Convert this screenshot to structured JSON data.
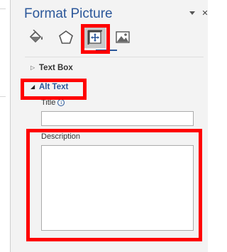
{
  "pane": {
    "title": "Format Picture",
    "controls": {
      "options_icon": "dropdown-caret-icon",
      "close_label": "✕"
    },
    "icon_tabs": [
      {
        "name": "fill-line",
        "icon": "paint-bucket-icon"
      },
      {
        "name": "effects",
        "icon": "pentagon-icon"
      },
      {
        "name": "size-properties",
        "icon": "size-properties-icon",
        "active": true
      },
      {
        "name": "picture",
        "icon": "picture-icon"
      }
    ],
    "sections": {
      "text_box": {
        "label": "Text Box",
        "arrow": "▷"
      },
      "alt_text": {
        "label": "Alt Text",
        "arrow": "◢"
      }
    },
    "fields": {
      "title_label": "Title",
      "title_info": "i",
      "title_value": "",
      "description_label": "Description",
      "description_value": ""
    }
  },
  "colors": {
    "accent": "#2b579a",
    "highlight": "#ff0000",
    "pane_background": "#f3f3f3"
  }
}
